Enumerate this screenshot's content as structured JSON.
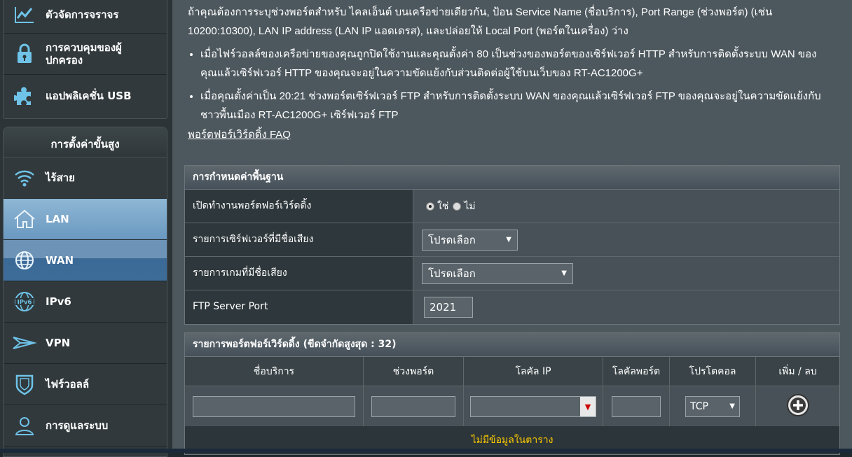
{
  "sidebar": {
    "top_items": [
      {
        "label": "ตัวจัดการจราจร",
        "icon": "traffic-chart-icon"
      },
      {
        "label": "การควบคุมของผู้ปกครอง",
        "icon": "parental-lock-icon"
      },
      {
        "label": "แอปพลิเคชั่น USB",
        "icon": "puzzle-icon"
      }
    ],
    "advanced_title": "การตั้งค่าขั้นสูง",
    "advanced_items": [
      {
        "label": "ไร้สาย",
        "icon": "wifi-icon"
      },
      {
        "label": "LAN",
        "icon": "home-icon"
      },
      {
        "label": "WAN",
        "icon": "globe-icon"
      },
      {
        "label": "IPv6",
        "icon": "ipv6-icon"
      },
      {
        "label": "VPN",
        "icon": "vpn-icon"
      },
      {
        "label": "ไฟร์วอลล์",
        "icon": "shield-icon"
      },
      {
        "label": "การดูแลระบบ",
        "icon": "user-icon"
      }
    ]
  },
  "main": {
    "intro": "ถ้าคุณต้องการระบุช่วงพอร์ตสำหรับ ไคลเอ็นต์ บนเครือข่ายเดียวกัน, ป้อน Service Name (ชื่อบริการ), Port Range (ช่วงพอร์ต) (เช่น 10200:10300), LAN IP address (LAN IP แอดเดรส), และปล่อยให้ Local Port (พอร์ตในเครื่อง) ว่าง",
    "bullets": [
      "เมื่อไฟร์วอลล์ของเครือข่ายของคุณถูกปิดใช้งานและคุณตั้งค่า 80 เป็นช่วงของพอร์ตของเซิร์ฟเวอร์ HTTP สำหรับการติดตั้งระบบ WAN ของคุณแล้วเซิร์ฟเวอร์ HTTP ของคุณจะอยู่ในความขัดแย้งกับส่วนติดต่อผู้ใช้บนเว็บของ RT-AC1200G+",
      "เมื่อคุณตั้งค่าเป็น 20:21 ช่วงพอร์ตเซิร์ฟเวอร์ FTP สำหรับการติดตั้งระบบ WAN ของคุณแล้วเซิร์ฟเวอร์ FTP ของคุณจะอยู่ในความขัดแย้งกับชาวพื้นเมือง RT-AC1200G+ เซิร์ฟเวอร์ FTP"
    ],
    "faq_link": "พอร์ตฟอร์เวิร์ดดิ้ง  FAQ"
  },
  "basic": {
    "title": "การกำหนดค่าพื้นฐาน",
    "enable_label": "เปิดทำงานพอร์ตฟอร์เวิร์ดดิ้ง",
    "yes_label": "ใช่",
    "no_label": "ไม่",
    "enabled": true,
    "server_list_label": "รายการเซิร์ฟเวอร์ที่มีชื่อเสียง",
    "server_list_value": "โปรดเลือก",
    "game_list_label": "รายการเกมที่มีชื่อเสียง",
    "game_list_value": "โปรดเลือก",
    "ftp_label": "FTP Server Port",
    "ftp_value": "2021"
  },
  "forward_list": {
    "title": "รายการพอร์ตฟอร์เวิร์ดดิ้ง (ขีดจำกัดสูงสุด : 32)",
    "columns": [
      "ชื่อบริการ",
      "ช่วงพอร์ต",
      "โลคัล IP",
      "โลคัลพอร์ต",
      "โปรโตคอล",
      "เพิ่ม / ลบ"
    ],
    "protocol_value": "TCP",
    "empty_text": "ไม่มีข้อมูลในตาราง"
  }
}
